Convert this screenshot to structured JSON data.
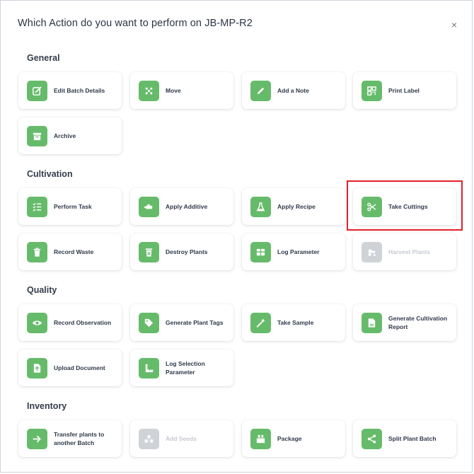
{
  "title": "Which Action do you want to perform on JB-MP-R2",
  "close_label": "×",
  "sections": {
    "general": "General",
    "cultivation": "Cultivation",
    "quality": "Quality",
    "inventory": "Inventory"
  },
  "actions": {
    "edit_batch": "Edit Batch Details",
    "move": "Move",
    "add_note": "Add a Note",
    "print_label": "Print Label",
    "archive": "Archive",
    "perform_task": "Perform Task",
    "apply_additive": "Apply Additive",
    "apply_recipe": "Apply Recipe",
    "take_cuttings": "Take Cuttings",
    "record_waste": "Record Waste",
    "destroy_plants": "Destroy Plants",
    "log_parameter": "Log Parameter",
    "harvest_plants": "Harvest Plants",
    "record_observation": "Record Observation",
    "generate_plant_tags": "Generate Plant Tags",
    "take_sample": "Take Sample",
    "generate_cultivation_report": "Generate Cultivation Report",
    "upload_document": "Upload Document",
    "log_selection_parameter": "Log Selection Parameter",
    "transfer_plants": "Transfer plants to another Batch",
    "add_seeds": "Add Seeds",
    "package": "Package",
    "split_plant_batch": "Split Plant Batch"
  },
  "colors": {
    "icon_green": "#66bb6a",
    "disabled_gray": "#cfd3d8",
    "highlight_red": "#e3202a"
  }
}
